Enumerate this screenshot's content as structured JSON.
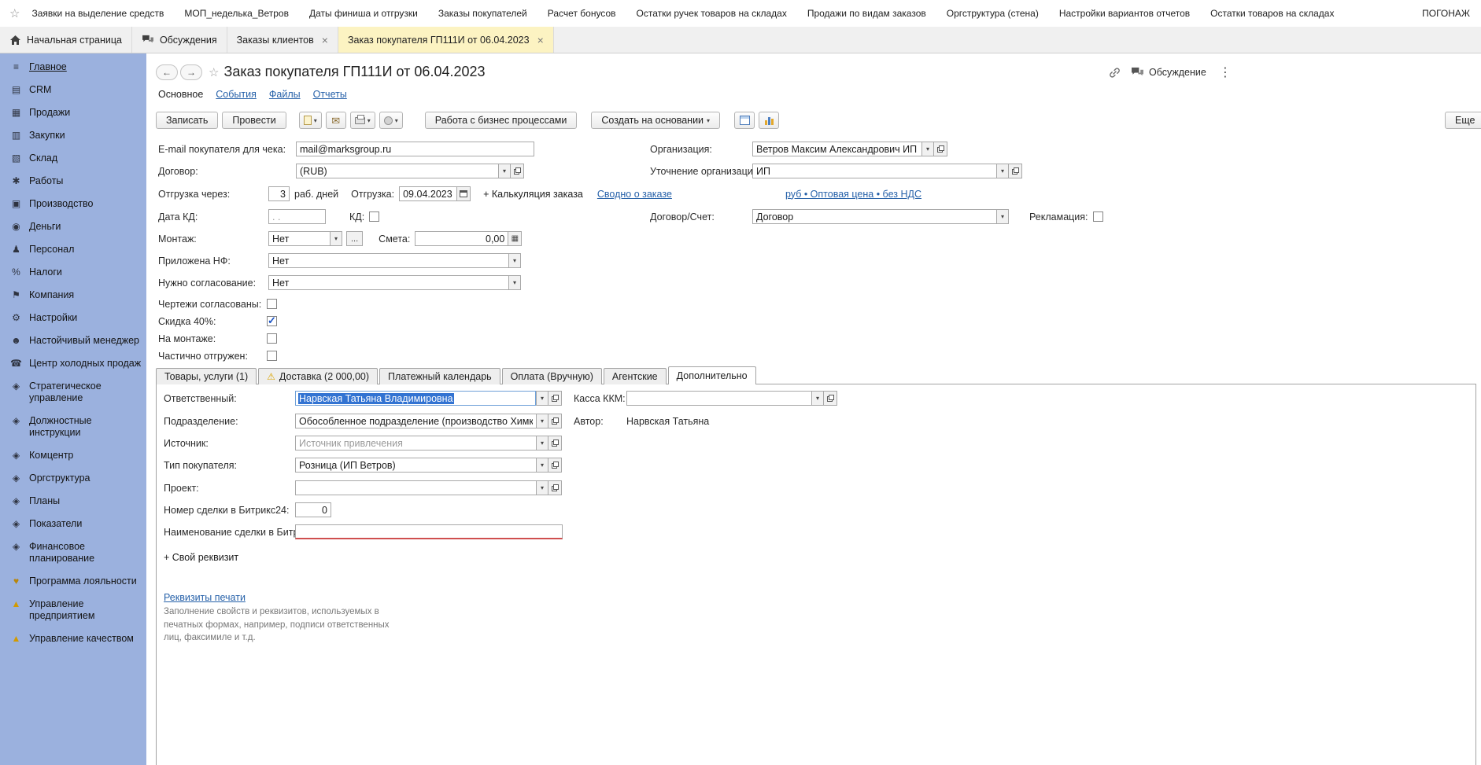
{
  "colors": {
    "sidebar_bg": "#9bb1de",
    "active_window_tab": "#fcf3c2",
    "link": "#2661a9",
    "selection": "#3273d2",
    "required_underline": "#cf4f4f",
    "warning": "#dba400",
    "checkbox_check": "#1a53c4"
  },
  "top_bar": {
    "links": [
      "Заявки на выделение средств",
      "МОП_неделька_Ветров",
      "Даты финиша и отгрузки",
      "Заказы покупателей",
      "Расчет бонусов",
      "Остатки ручек товаров на складах",
      "Продажи по видам заказов",
      "Оргструктура (стена)",
      "Настройки вариантов отчетов",
      "Остатки товаров на складах",
      "ПОГОНАЖ"
    ]
  },
  "window_tabs": [
    {
      "label": "Начальная страница"
    },
    {
      "label": "Обсуждения"
    },
    {
      "label": "Заказы клиентов",
      "closable": true
    },
    {
      "label": "Заказ покупателя ГП111И от 06.04.2023",
      "closable": true,
      "active": true
    }
  ],
  "sidebar": {
    "items": [
      {
        "icon": "≡",
        "label": "Главное",
        "active": true
      },
      {
        "icon": "▤",
        "label": "CRM"
      },
      {
        "icon": "▦",
        "label": "Продажи"
      },
      {
        "icon": "▥",
        "label": "Закупки"
      },
      {
        "icon": "▧",
        "label": "Склад"
      },
      {
        "icon": "✱",
        "label": "Работы"
      },
      {
        "icon": "▣",
        "label": "Производство"
      },
      {
        "icon": "◉",
        "label": "Деньги"
      },
      {
        "icon": "♟",
        "label": "Персонал"
      },
      {
        "icon": "%",
        "label": "Налоги"
      },
      {
        "icon": "⚑",
        "label": "Компания"
      },
      {
        "icon": "⚙",
        "label": "Настройки"
      },
      {
        "icon": "☻",
        "label": "Настойчивый менеджер"
      },
      {
        "icon": "☎",
        "label": "Центр холодных продаж"
      },
      {
        "icon": "◈",
        "label": "Стратегическое управление"
      },
      {
        "icon": "◈",
        "label": "Должностные инструкции"
      },
      {
        "icon": "◈",
        "label": "Комцентр"
      },
      {
        "icon": "◈",
        "label": "Оргструктура"
      },
      {
        "icon": "◈",
        "label": "Планы"
      },
      {
        "icon": "◈",
        "label": "Показатели"
      },
      {
        "icon": "◈",
        "label": "Финансовое планирование"
      },
      {
        "icon": "♥",
        "label": "Программа лояльности",
        "iconColor": "#b8860b"
      },
      {
        "icon": "▲",
        "label": "Управление предприятием",
        "iconColor": "#d29a00"
      },
      {
        "icon": "▲",
        "label": "Управление качеством",
        "iconColor": "#d29a00"
      }
    ]
  },
  "header": {
    "title": "Заказ покупателя ГП111И от 06.04.2023",
    "discussion": "Обсуждение",
    "nav": {
      "main": "Основное",
      "events": "События",
      "files": "Файлы",
      "reports": "Отчеты"
    }
  },
  "toolbar": {
    "write": "Записать",
    "post": "Провести",
    "business_process": "Работа с бизнес процессами",
    "create_based_on": "Создать на основании",
    "more": "Еще"
  },
  "form": {
    "email_label": "E-mail покупателя для чека:",
    "email_value": "mail@marksgroup.ru",
    "contract_label": "Договор:",
    "contract_value": "(RUB)",
    "ship_after_label": "Отгрузка через:",
    "ship_after_value": "3",
    "ship_after_suffix": "раб. дней",
    "shipping_label": "Отгрузка:",
    "shipping_date": "09.04.2023",
    "calculation_link": "+ Калькуляция заказа",
    "order_summary_link": "Сводно о заказе",
    "kd_date_label": "Дата КД:",
    "kd_date_placeholder": ". .",
    "kd_label": "КД:",
    "kd_checked": false,
    "montage_label": "Монтаж:",
    "montage_value": "Нет",
    "montage_ellipsis": "...",
    "estimate_label": "Смета:",
    "estimate_value": "0,00",
    "nf_label": "Приложена НФ:",
    "nf_value": "Нет",
    "approval_label": "Нужно согласование:",
    "approval_value": "Нет",
    "drawings_label": "Чертежи согласованы:",
    "drawings_checked": false,
    "discount_label": "Скидка 40%:",
    "discount_checked": true,
    "on_montage_label": "На монтаже:",
    "on_montage_checked": false,
    "partially_shipped_label": "Частично отгружен:",
    "partially_shipped_checked": false,
    "organization_label": "Организация:",
    "organization_value": "Ветров Максим Александрович ИП",
    "org_clarification_label": "Уточнение организации:",
    "org_clarification_value": "ИП",
    "price_type_link": "руб • Оптовая цена • без НДС",
    "contract_account_label": "Договор/Счет:",
    "contract_account_value": "Договор",
    "reclamation_label": "Рекламация:",
    "reclamation_checked": false
  },
  "bottom_tabs": {
    "goods": "Товары, услуги (1)",
    "delivery": "Доставка (2 000,00)",
    "payment_calendar": "Платежный календарь",
    "payment": "Оплата (Вручную)",
    "agency": "Агентские",
    "additional": "Дополнительно"
  },
  "details": {
    "responsible_label": "Ответственный:",
    "responsible_value": "Нарвская Татьяна Владимировна",
    "kkm_label": "Касса ККМ:",
    "kkm_value": "",
    "department_label": "Подразделение:",
    "department_value": "Обособленное подразделение (производство Химки)",
    "author_label": "Автор:",
    "author_value": "Нарвская Татьяна",
    "source_label": "Источник:",
    "source_placeholder": "Источник привлечения",
    "buyer_type_label": "Тип покупателя:",
    "buyer_type_value": "Розница (ИП Ветров)",
    "project_label": "Проект:",
    "project_value": "",
    "bitrix_number_label": "Номер сделки в Битрикс24:",
    "bitrix_number_value": "0",
    "bitrix_name_label": "Наименование сделки в Битрикс:",
    "bitrix_name_value": "",
    "custom_attr_link": "+ Свой реквизит",
    "print_props_link": "Реквизиты печати",
    "print_props_hint": "Заполнение свойств и реквизитов, используемых в печатных формах, например, подписи ответственных лиц, факсимиле и т.д."
  }
}
